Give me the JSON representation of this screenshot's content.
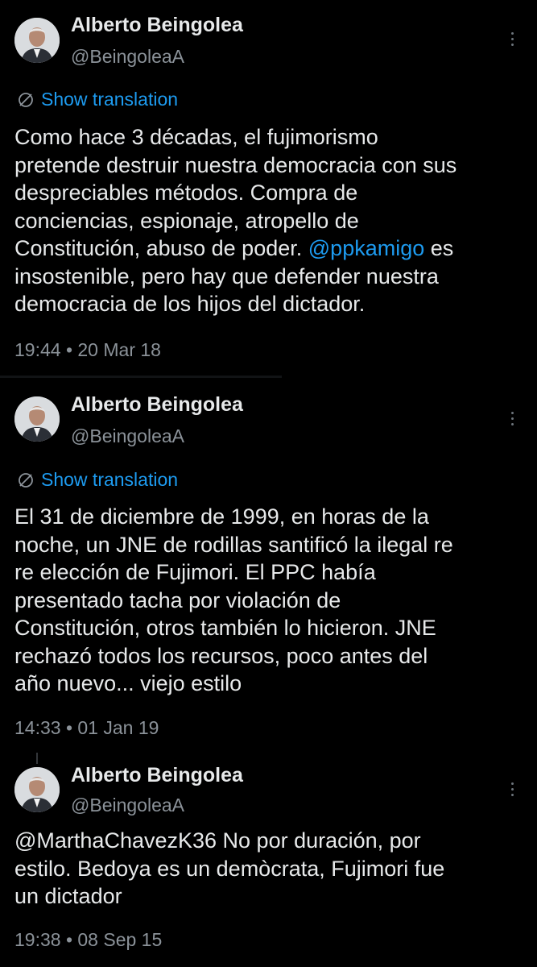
{
  "colors": {
    "background": "#000000",
    "text": "#e7e9ea",
    "secondary": "#8b9299",
    "link": "#1d9bf0"
  },
  "tweets": [
    {
      "author_name": "Alberto Beingolea",
      "author_handle": "@BeingoleaA",
      "show_translation": "Show translation",
      "text_before": "Como hace 3 décadas, el fujimorismo\npretende destruir nuestra democracia con sus\ndespreciables métodos. Compra de\nconciencias, espionaje, atropello de\nConstitución, abuso de poder. ",
      "mention": "@ppkamigo",
      "text_after": " es\ninsostenible, pero hay que defender nuestra\ndemocracia de los hijos del dictador.",
      "timestamp": "19:44 • 20 Mar 18",
      "more_icon": "more-vertical-icon",
      "translate_icon": "globe-icon"
    },
    {
      "author_name": "Alberto Beingolea",
      "author_handle": "@BeingoleaA",
      "show_translation": "Show translation",
      "text": "El 31 de diciembre de 1999, en horas de la\nnoche, un JNE de rodillas santificó la ilegal re\nre elección de Fujimori. El PPC había\npresentado tacha por violación de\nConstitución, otros también lo hicieron. JNE\nrechazó todos los recursos, poco antes del\naño nuevo... viejo estilo",
      "timestamp": "14:33 • 01 Jan 19",
      "more_icon": "more-vertical-icon",
      "translate_icon": "globe-icon"
    },
    {
      "author_name": "Alberto Beingolea",
      "author_handle": "@BeingoleaA",
      "text": "@MarthaChavezK36 No por duración, por\nestilo. Bedoya es un demòcrata, Fujimori fue\nun dictador",
      "timestamp": "19:38 • 08 Sep 15",
      "more_icon": "more-vertical-icon"
    }
  ]
}
